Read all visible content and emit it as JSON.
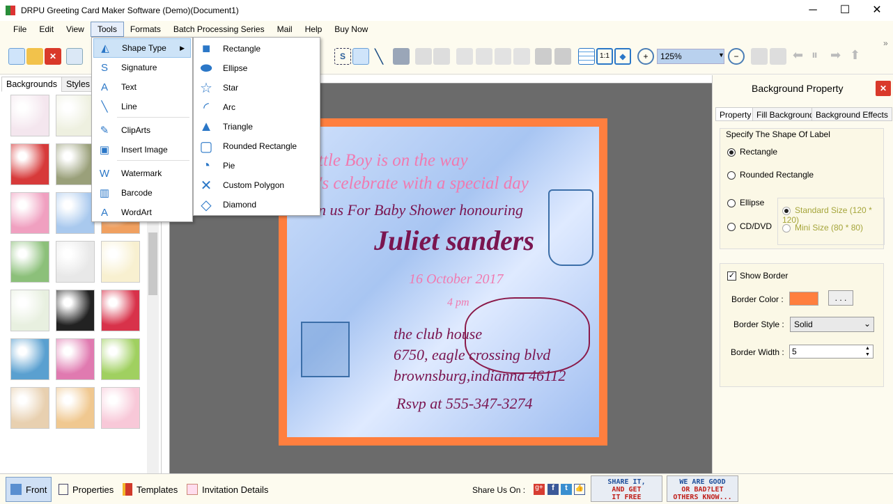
{
  "window": {
    "title": "DRPU Greeting Card Maker Software (Demo)(Document1)",
    "minimize": "─",
    "maximize": "☐",
    "close": "✕"
  },
  "menubar": [
    "File",
    "Edit",
    "View",
    "Tools",
    "Formats",
    "Batch Processing Series",
    "Mail",
    "Help",
    "Buy Now"
  ],
  "toolbar": {
    "zoom": "125%",
    "overflow": "»"
  },
  "left_panel": {
    "tabs": [
      "Backgrounds",
      "Styles"
    ]
  },
  "tools_menu": [
    {
      "label": "Shape Type",
      "icon": "shape-type-icon"
    },
    {
      "label": "Signature",
      "icon": "signature-icon"
    },
    {
      "label": "Text",
      "icon": "text-icon"
    },
    {
      "label": "Line",
      "icon": "line-icon"
    },
    {
      "label": "ClipArts",
      "icon": "clipart-icon"
    },
    {
      "label": "Insert Image",
      "icon": "image-icon"
    },
    {
      "label": "Watermark",
      "icon": "watermark-icon"
    },
    {
      "label": "Barcode",
      "icon": "barcode-icon"
    },
    {
      "label": "WordArt",
      "icon": "wordart-icon"
    }
  ],
  "shape_menu": [
    {
      "label": "Rectangle",
      "glyph": "■"
    },
    {
      "label": "Ellipse",
      "glyph": "⬬"
    },
    {
      "label": "Star",
      "glyph": "☆"
    },
    {
      "label": "Arc",
      "glyph": "◜"
    },
    {
      "label": "Triangle",
      "glyph": "▲"
    },
    {
      "label": "Rounded Rectangle",
      "glyph": "▢"
    },
    {
      "label": "Pie",
      "glyph": "◔"
    },
    {
      "label": "Custom Polygon",
      "glyph": "✕"
    },
    {
      "label": "Diamond",
      "glyph": "◇"
    }
  ],
  "card": {
    "line1": "ttle Boy is on the way",
    "line2": "'s celebrate with a special day",
    "line3": "n us For Baby Shower honouring",
    "name": "Juliet  sanders",
    "date": "16 October 2017",
    "time": "4 pm",
    "addr1": "the club house",
    "addr2": "6750, eagle crossing blvd",
    "addr3": "brownsburg,indianna 46112",
    "rsvp": "Rsvp at 555-347-3274",
    "border_color": "#ff7f3f"
  },
  "right_panel": {
    "title": "Background Property",
    "tabs": [
      "Property",
      "Fill Background",
      "Background Effects"
    ],
    "group_title": "Specify The Shape Of Label",
    "shapes": [
      {
        "label": "Rectangle",
        "selected": true
      },
      {
        "label": "Rounded Rectangle",
        "selected": false
      },
      {
        "label": "Ellipse",
        "selected": false
      },
      {
        "label": "CD/DVD",
        "selected": false
      }
    ],
    "sizes": [
      {
        "label": "Standard Size (120 * 120)",
        "selected": true
      },
      {
        "label": "Mini Size (80 * 80)",
        "selected": false
      }
    ],
    "show_border": "Show Border",
    "show_border_checked": true,
    "border_color_label": "Border Color :",
    "border_color": "#ff7f3f",
    "browse": ". . .",
    "border_style_label": "Border Style :",
    "border_style": "Solid",
    "border_width_label": "Border Width :",
    "border_width": "5"
  },
  "bottom": {
    "buttons": [
      "Front",
      "Properties",
      "Templates",
      "Invitation Details"
    ],
    "share_label": "Share Us On :",
    "promo1": [
      "SHARE IT,",
      "AND GET",
      "IT FREE"
    ],
    "promo2": [
      "WE ARE GOOD",
      "OR BAD?LET",
      "OTHERS KNOW..."
    ]
  }
}
